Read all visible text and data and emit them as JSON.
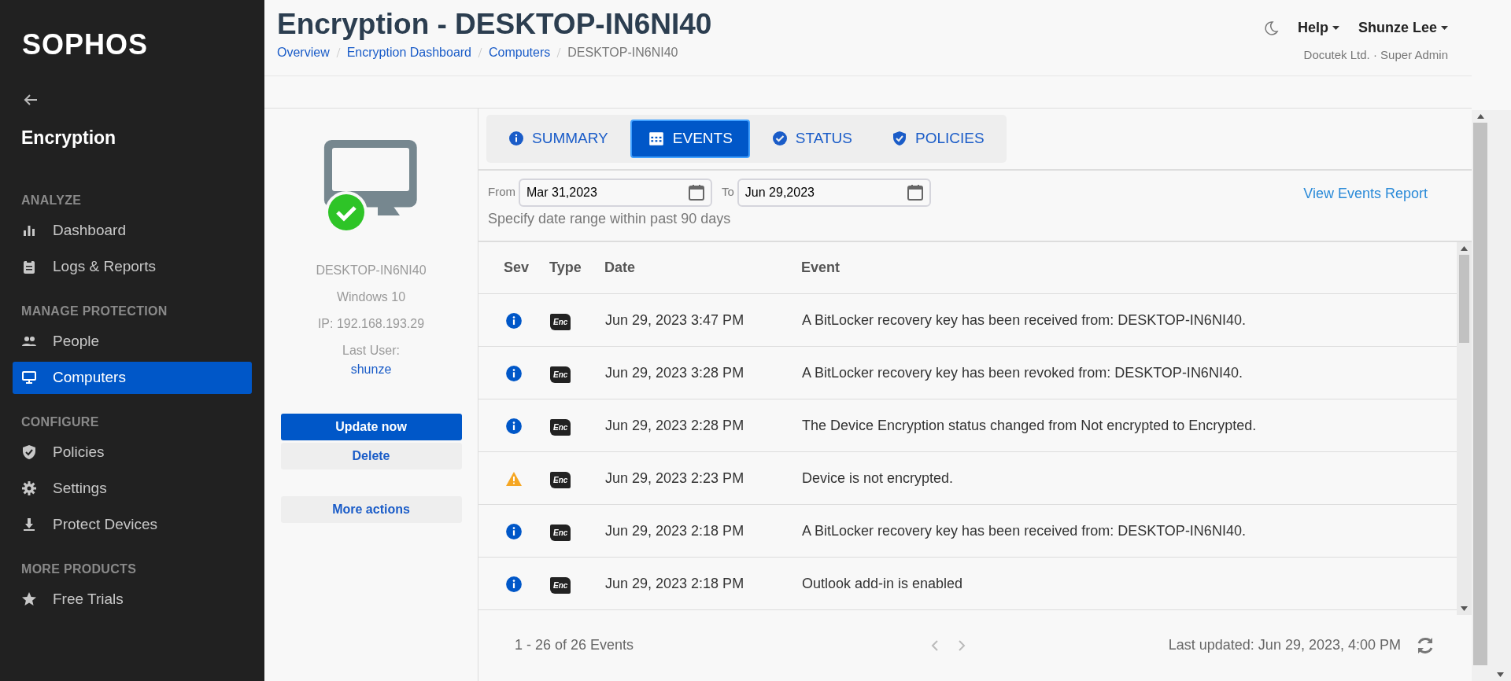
{
  "sidebar": {
    "logo": "SOPHOS",
    "title": "Encryption",
    "sections": [
      {
        "heading": "ANALYZE",
        "items": [
          {
            "label": "Dashboard",
            "selected": false
          },
          {
            "label": "Logs & Reports",
            "selected": false
          }
        ]
      },
      {
        "heading": "MANAGE PROTECTION",
        "items": [
          {
            "label": "People",
            "selected": false
          },
          {
            "label": "Computers",
            "selected": true
          }
        ]
      },
      {
        "heading": "CONFIGURE",
        "items": [
          {
            "label": "Policies",
            "selected": false
          },
          {
            "label": "Settings",
            "selected": false
          },
          {
            "label": "Protect Devices",
            "selected": false
          }
        ]
      },
      {
        "heading": "MORE PRODUCTS",
        "items": [
          {
            "label": "Free Trials",
            "selected": false
          }
        ]
      }
    ]
  },
  "header": {
    "title": "Encryption - DESKTOP-IN6NI40",
    "breadcrumbs": [
      "Overview",
      "Encryption Dashboard",
      "Computers",
      "DESKTOP-IN6NI40"
    ],
    "help": "Help",
    "user": "Shunze Lee",
    "account": "Docutek Ltd. · Super Admin"
  },
  "device": {
    "healthy": true,
    "name": "DESKTOP-IN6NI40",
    "os": "Windows 10",
    "ip": "IP: 192.168.193.29",
    "last_user_label": "Last User:",
    "last_user": "shunze",
    "buttons": [
      "Update now",
      "Delete"
    ],
    "more_actions": "More actions"
  },
  "tabs": [
    {
      "label": "SUMMARY",
      "selected": false
    },
    {
      "label": "EVENTS",
      "selected": true
    },
    {
      "label": "STATUS",
      "selected": false
    },
    {
      "label": "POLICIES",
      "selected": false
    }
  ],
  "filter": {
    "from_label": "From",
    "from": "Mar 31,2023",
    "to_label": "To",
    "to": "Jun 29,2023",
    "hint": "Specify date range within past 90 days",
    "report_link": "View Events Report"
  },
  "table": {
    "columns": [
      "Sev",
      "Type",
      "Date",
      "Event"
    ],
    "rows": [
      {
        "kind": "info",
        "type": "Enc",
        "date": "Jun 29, 2023 3:47 PM",
        "event": "A BitLocker recovery key has been received from: DESKTOP-IN6NI40."
      },
      {
        "kind": "info",
        "type": "Enc",
        "date": "Jun 29, 2023 3:28 PM",
        "event": "A BitLocker recovery key has been revoked from: DESKTOP-IN6NI40."
      },
      {
        "kind": "info",
        "type": "Enc",
        "date": "Jun 29, 2023 2:28 PM",
        "event": "The Device Encryption status changed from Not encrypted to Encrypted."
      },
      {
        "kind": "warning",
        "type": "Enc",
        "date": "Jun 29, 2023 2:23 PM",
        "event": "Device is not encrypted."
      },
      {
        "kind": "info",
        "type": "Enc",
        "date": "Jun 29, 2023 2:18 PM",
        "event": "A BitLocker recovery key has been received from: DESKTOP-IN6NI40."
      },
      {
        "kind": "info",
        "type": "Enc",
        "date": "Jun 29, 2023 2:18 PM",
        "event": "Outlook add-in is enabled"
      }
    ]
  },
  "footer": {
    "count": "1 - 26 of 26 Events",
    "updated": "Last updated: Jun 29, 2023, 4:00 PM"
  }
}
